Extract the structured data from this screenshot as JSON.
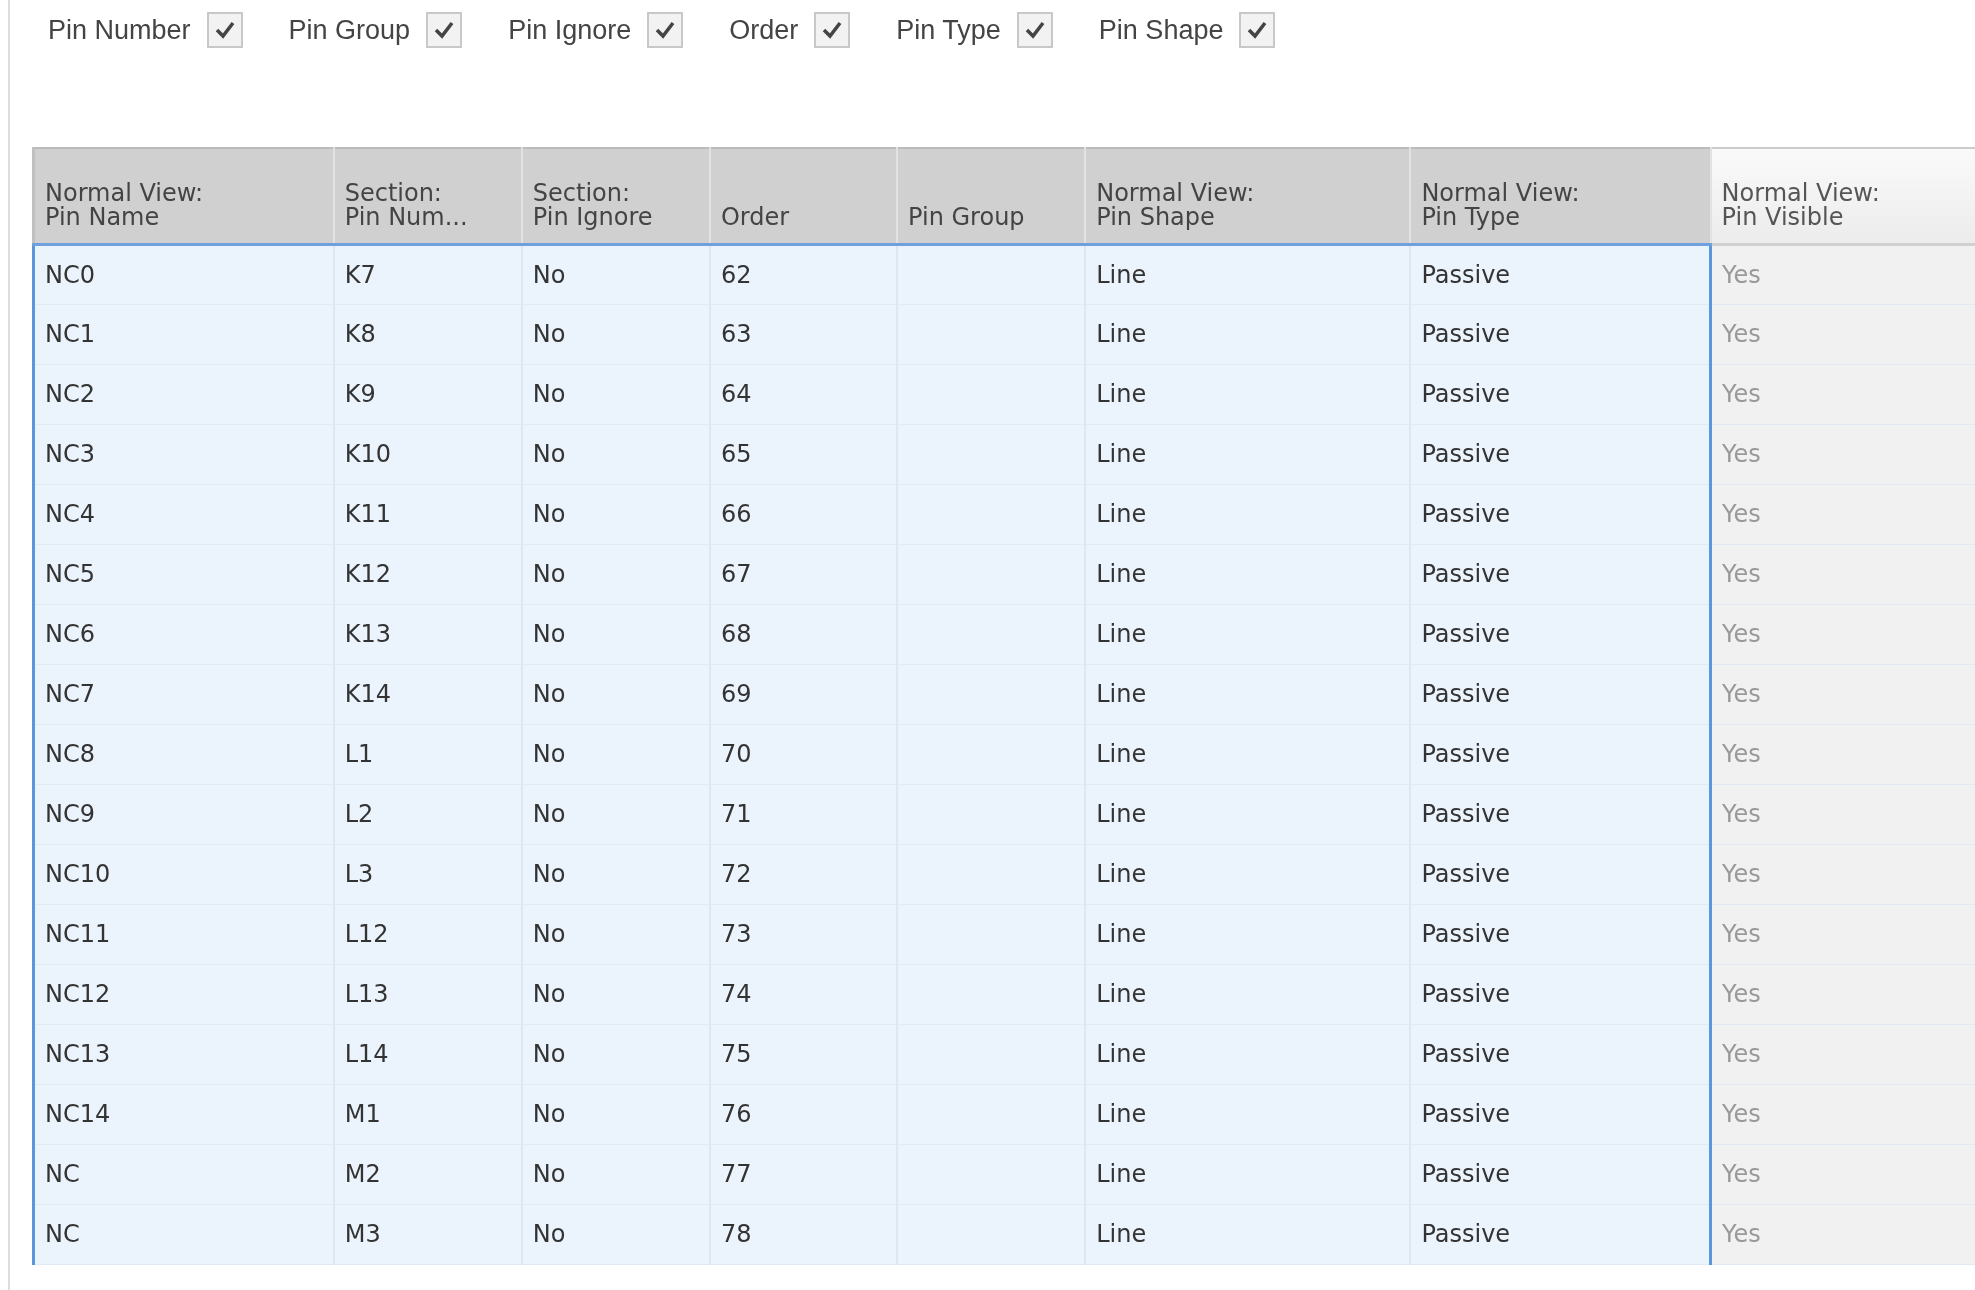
{
  "filters": [
    {
      "label": "Pin Number",
      "checked": true
    },
    {
      "label": "Pin Group",
      "checked": true
    },
    {
      "label": "Pin Ignore",
      "checked": true
    },
    {
      "label": "Order",
      "checked": true
    },
    {
      "label": "Pin Type",
      "checked": true
    },
    {
      "label": "Pin Shape",
      "checked": true
    }
  ],
  "table": {
    "columns": [
      {
        "label": "Normal View:\nPin Name",
        "selected": true,
        "disabled": false
      },
      {
        "label": "Section:\nPin Num...",
        "selected": true,
        "disabled": false
      },
      {
        "label": "Section:\nPin Ignore",
        "selected": true,
        "disabled": false
      },
      {
        "label": "Order",
        "selected": true,
        "disabled": false
      },
      {
        "label": "Pin Group",
        "selected": true,
        "disabled": false
      },
      {
        "label": "Normal View:\nPin Shape",
        "selected": true,
        "disabled": false
      },
      {
        "label": "Normal View:\nPin Type",
        "selected": true,
        "disabled": false
      },
      {
        "label": "Normal View:\nPin Visible",
        "selected": false,
        "disabled": true
      }
    ],
    "rows": [
      [
        "NC0",
        "K7",
        "No",
        "62",
        "",
        "Line",
        "Passive",
        "Yes"
      ],
      [
        "NC1",
        "K8",
        "No",
        "63",
        "",
        "Line",
        "Passive",
        "Yes"
      ],
      [
        "NC2",
        "K9",
        "No",
        "64",
        "",
        "Line",
        "Passive",
        "Yes"
      ],
      [
        "NC3",
        "K10",
        "No",
        "65",
        "",
        "Line",
        "Passive",
        "Yes"
      ],
      [
        "NC4",
        "K11",
        "No",
        "66",
        "",
        "Line",
        "Passive",
        "Yes"
      ],
      [
        "NC5",
        "K12",
        "No",
        "67",
        "",
        "Line",
        "Passive",
        "Yes"
      ],
      [
        "NC6",
        "K13",
        "No",
        "68",
        "",
        "Line",
        "Passive",
        "Yes"
      ],
      [
        "NC7",
        "K14",
        "No",
        "69",
        "",
        "Line",
        "Passive",
        "Yes"
      ],
      [
        "NC8",
        "L1",
        "No",
        "70",
        "",
        "Line",
        "Passive",
        "Yes"
      ],
      [
        "NC9",
        "L2",
        "No",
        "71",
        "",
        "Line",
        "Passive",
        "Yes"
      ],
      [
        "NC10",
        "L3",
        "No",
        "72",
        "",
        "Line",
        "Passive",
        "Yes"
      ],
      [
        "NC11",
        "L12",
        "No",
        "73",
        "",
        "Line",
        "Passive",
        "Yes"
      ],
      [
        "NC12",
        "L13",
        "No",
        "74",
        "",
        "Line",
        "Passive",
        "Yes"
      ],
      [
        "NC13",
        "L14",
        "No",
        "75",
        "",
        "Line",
        "Passive",
        "Yes"
      ],
      [
        "NC14",
        "M1",
        "No",
        "76",
        "",
        "Line",
        "Passive",
        "Yes"
      ],
      [
        "NC",
        "M2",
        "No",
        "77",
        "",
        "Line",
        "Passive",
        "Yes"
      ],
      [
        "NC",
        "M3",
        "No",
        "78",
        "",
        "Line",
        "Passive",
        "Yes"
      ]
    ]
  }
}
